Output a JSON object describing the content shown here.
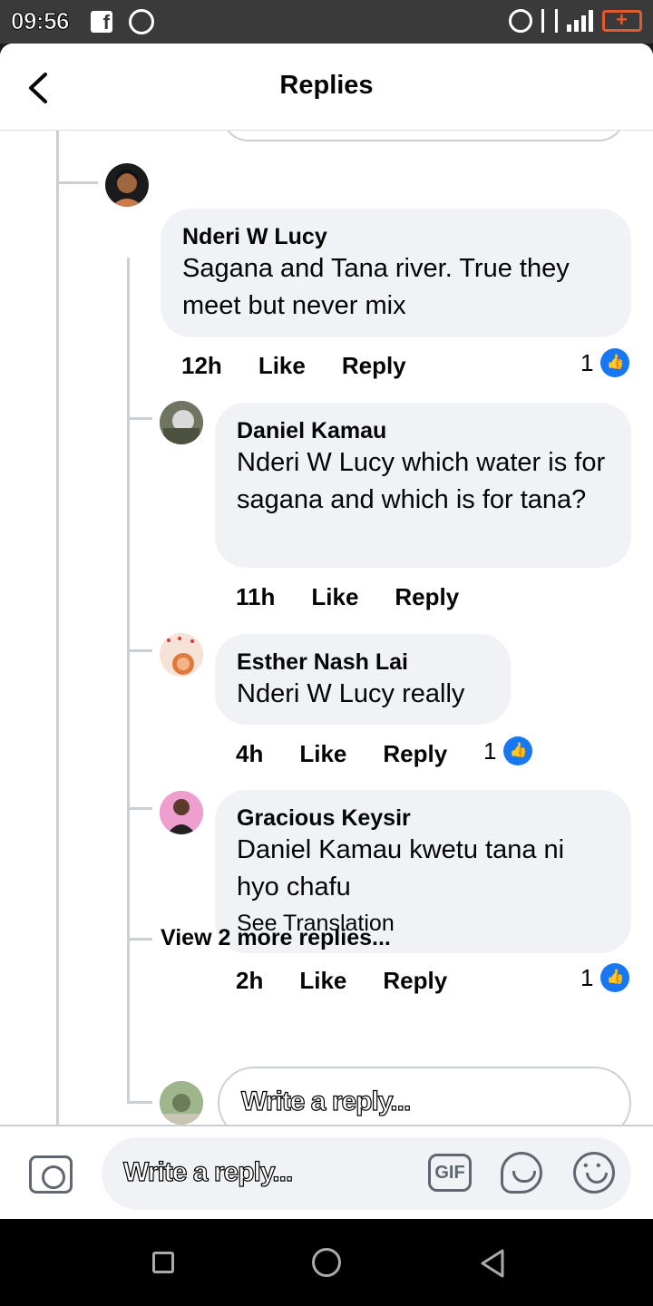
{
  "status_bar": {
    "time": "09:56"
  },
  "header": {
    "title": "Replies"
  },
  "comments": [
    {
      "author": "Nderi W Lucy",
      "text": "Sagana and Tana river. True they meet but never mix",
      "time": "12h",
      "like": "Like",
      "reply": "Reply",
      "likes": "1"
    },
    {
      "author": "Daniel Kamau",
      "text": "Nderi W Lucy which water is for sagana and which is for tana?",
      "time": "11h",
      "like": "Like",
      "reply": "Reply"
    },
    {
      "author": "Esther Nash Lai",
      "text": "Nderi W Lucy really",
      "time": "4h",
      "like": "Like",
      "reply": "Reply",
      "likes": "1"
    },
    {
      "author": "Gracious Keysir",
      "text": "Daniel Kamau kwetu tana ni hyo chafu",
      "translate": "See Translation",
      "time": "2h",
      "like": "Like",
      "reply": "Reply",
      "likes": "1"
    }
  ],
  "view_more": "View 2 more replies...",
  "inline_reply": {
    "placeholder": "Write a reply..."
  },
  "composer": {
    "placeholder": "Write a reply...",
    "gif_label": "GIF"
  },
  "icons": [
    "back-icon",
    "camera-icon",
    "gif-icon",
    "sticker-icon",
    "emoji-icon",
    "like-icon"
  ],
  "colors": {
    "accent": "#1877f2",
    "bubble": "#f0f2f5",
    "thread_line": "#ccd0d5"
  }
}
